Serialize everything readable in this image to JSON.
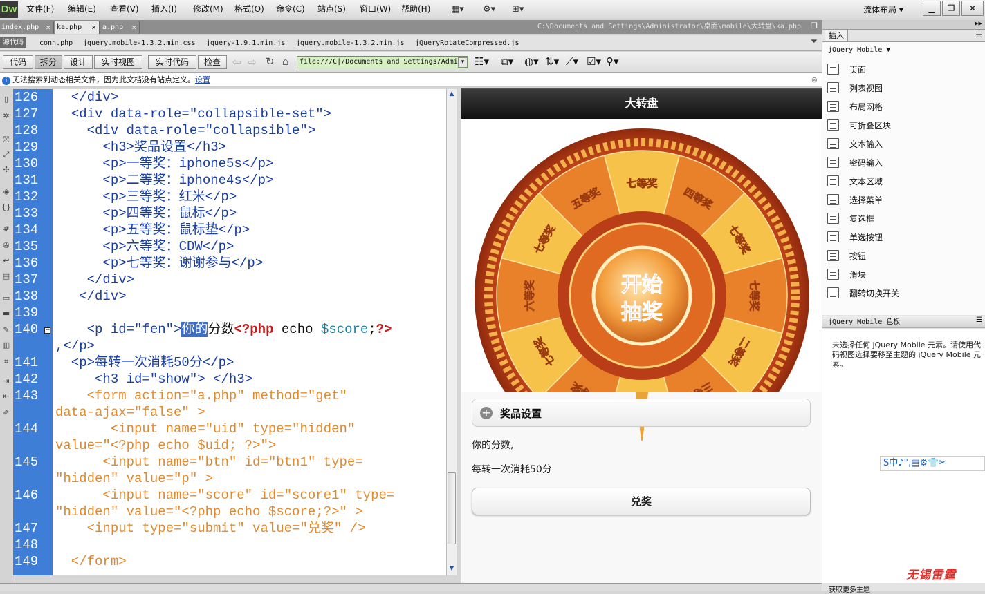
{
  "app": {
    "logo": "Dw",
    "menus": [
      "文件(F)",
      "编辑(E)",
      "查看(V)",
      "插入(I)",
      "修改(M)",
      "格式(O)",
      "命令(C)",
      "站点(S)",
      "窗口(W)",
      "帮助(H)"
    ],
    "layout": "流体布局",
    "win_min": "▁",
    "win_restore": "❐",
    "win_close": "✕"
  },
  "tabs": [
    {
      "label": "index.php",
      "close": "×"
    },
    {
      "label": "ka.php",
      "close": "×"
    },
    {
      "label": "a.php",
      "close": "×"
    }
  ],
  "file_path": "C:\\Documents and Settings\\Administrator\\桌面\\mobile\\大转盘\\ka.php",
  "related_files": {
    "source_label": "源代码",
    "files": [
      "conn.php",
      "jquery.mobile-1.3.2.min.css",
      "jquery-1.9.1.min.js",
      "jquery.mobile-1.3.2.min.js",
      "jQueryRotateCompressed.js"
    ]
  },
  "view_toolbar": {
    "code": "代码",
    "split": "拆分",
    "design": "设计",
    "live_view": "实时视图",
    "live_code": "实时代码",
    "inspect": "检查",
    "address": "file:///C|/Documents and Settings/Admi"
  },
  "info_bar": {
    "message": "无法搜索到动态相关文件，因为此文档没有站点定义。",
    "link": "设置"
  },
  "code_lines": [
    {
      "n": "126",
      "t": "  </div>"
    },
    {
      "n": "127",
      "t": "  <div data-role=\"collapsible-set\">"
    },
    {
      "n": "128",
      "t": "    <div data-role=\"collapsible\">"
    },
    {
      "n": "129",
      "t": "      <h3>奖品设置</h3>"
    },
    {
      "n": "130",
      "t": "      <p>一等奖：iphone5s</p>"
    },
    {
      "n": "131",
      "t": "      <p>二等奖：iphone4s</p>"
    },
    {
      "n": "132",
      "t": "      <p>三等奖：红米</p>"
    },
    {
      "n": "133",
      "t": "      <p>四等奖：鼠标</p>"
    },
    {
      "n": "134",
      "t": "      <p>五等奖：鼠标垫</p>"
    },
    {
      "n": "135",
      "t": "      <p>六等奖：CDW</p>"
    },
    {
      "n": "136",
      "t": "      <p>七等奖：谢谢参与</p>"
    },
    {
      "n": "137",
      "t": "    </div>"
    },
    {
      "n": "138",
      "t": "   </div>"
    },
    {
      "n": "139",
      "t": ""
    },
    {
      "n": "140",
      "a": "    <p id=\"fen\">",
      "sel": "你的",
      "b": "分数",
      "php1": "<?php",
      "c": " echo ",
      "v": "$score",
      "d": ";",
      "php2": "?>",
      "w": ",</p>"
    },
    {
      "n": "141",
      "t": "  <p>每转一次消耗50分</p>"
    },
    {
      "n": "142",
      "t": "     <h3 id=\"show\"> </h3>"
    },
    {
      "n": "143",
      "a": "    <form action=\"a.php\" method=\"get\"",
      "w": "data-ajax=\"false\" >"
    },
    {
      "n": "144",
      "a": "       <input name=\"uid\" type=\"hidden\"",
      "w": "value=\"<?php echo $uid; ?>\">"
    },
    {
      "n": "145",
      "a": "      <input name=\"btn\" id=\"btn1\" type=",
      "w": "\"hidden\" value=\"p\" >"
    },
    {
      "n": "146",
      "a": "      <input name=\"score\" id=\"score1\" type=",
      "w": "\"hidden\" value=\"<?php echo $score;?>\" >"
    },
    {
      "n": "147",
      "t": "    <input type=\"submit\" value=\"兑奖\" />"
    },
    {
      "n": "148",
      "t": ""
    },
    {
      "n": "149",
      "t": "  </form>"
    }
  ],
  "live": {
    "title": "大转盘",
    "wheel_center": [
      "开始",
      "抽奖"
    ],
    "wheel_labels": [
      "七等奖",
      "四等奖",
      "七等奖",
      "七等奖",
      "二等奖",
      "三等奖",
      "七等奖",
      "一等奖",
      "七等奖",
      "六等奖",
      "七等奖",
      "五等奖"
    ],
    "collapsible": "奖品设置",
    "score_text": "你的分数,",
    "cost_text": "每转一次消耗50分",
    "exchange_button": "兑奖"
  },
  "insert_panel": {
    "tab": "插入",
    "category": "jQuery Mobile",
    "items": [
      "页面",
      "列表视图",
      "布局网格",
      "可折叠区块",
      "文本输入",
      "密码输入",
      "文本区域",
      "选择菜单",
      "复选框",
      "单选按钮",
      "按钮",
      "滑块",
      "翻转切换开关"
    ]
  },
  "swatch_panel": {
    "title": "jQuery Mobile 色板",
    "message": "未选择任何 jQuery Mobile 元素。请使用代码视图选择要移至主题的 jQuery Mobile 元素。",
    "more_themes": "获取更多主题"
  },
  "ime": "S中♪°,▤⚙👕✂",
  "brand": "无锡雷霆"
}
